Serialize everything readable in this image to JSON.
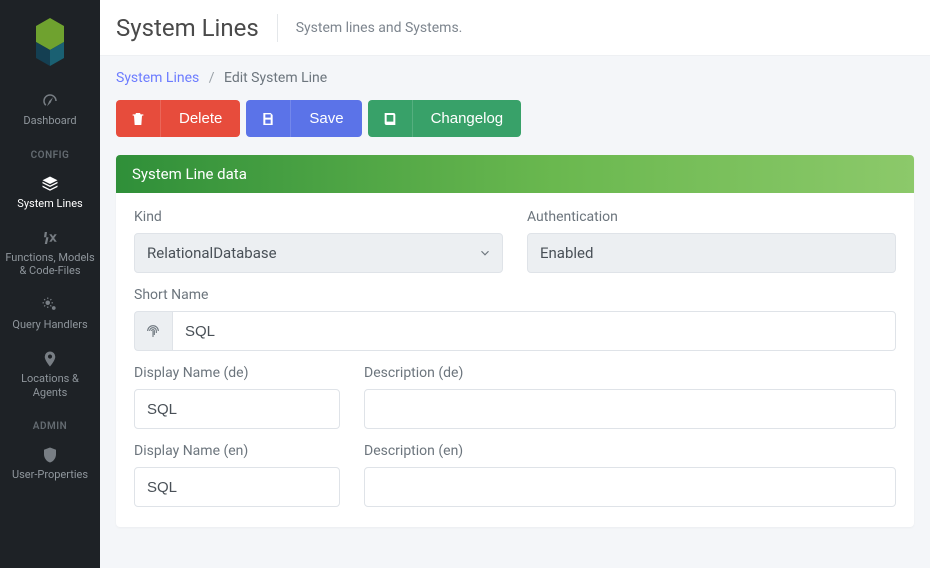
{
  "sidebar": {
    "items": [
      {
        "label": "Dashboard"
      }
    ],
    "sections": {
      "config": {
        "title": "CONFIG",
        "items": [
          {
            "label": "System Lines"
          },
          {
            "label": "Functions, Models & Code-Files"
          },
          {
            "label": "Query Handlers"
          },
          {
            "label": "Locations & Agents"
          }
        ]
      },
      "admin": {
        "title": "ADMIN",
        "items": [
          {
            "label": "User-Properties"
          }
        ]
      }
    }
  },
  "header": {
    "title": "System Lines",
    "subtitle": "System lines and Systems."
  },
  "breadcrumb": {
    "root": "System Lines",
    "current": "Edit System Line"
  },
  "actions": {
    "delete": "Delete",
    "save": "Save",
    "changelog": "Changelog"
  },
  "card": {
    "title": "System Line data",
    "fields": {
      "kind_label": "Kind",
      "kind_value": "RelationalDatabase",
      "auth_label": "Authentication",
      "auth_value": "Enabled",
      "shortname_label": "Short Name",
      "shortname_value": "SQL",
      "display_de_label": "Display Name (de)",
      "display_de_value": "SQL",
      "desc_de_label": "Description (de)",
      "desc_de_value": "",
      "display_en_label": "Display Name (en)",
      "display_en_value": "SQL",
      "desc_en_label": "Description (en)",
      "desc_en_value": ""
    }
  }
}
